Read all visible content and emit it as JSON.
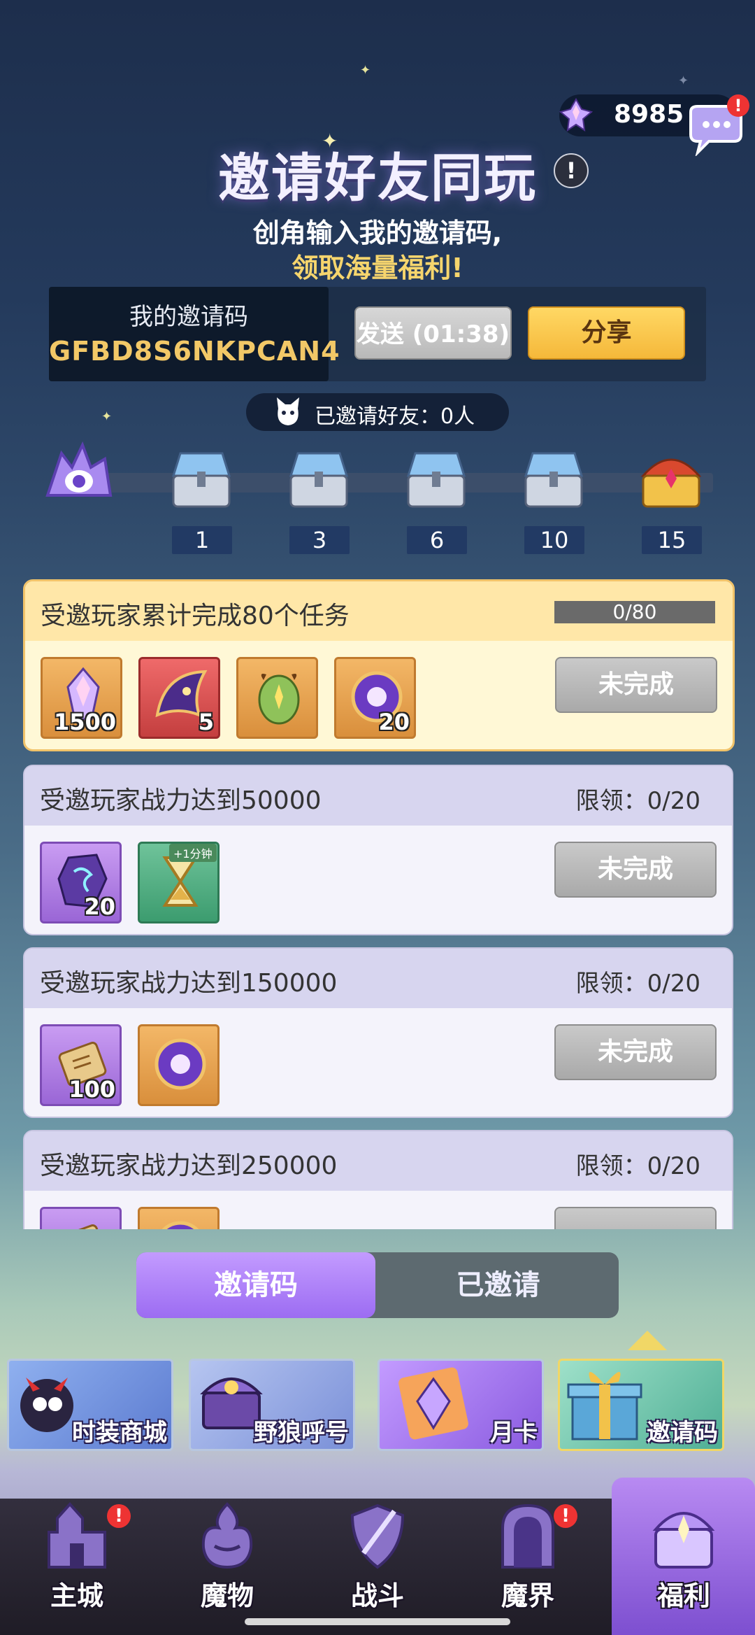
{
  "currency": {
    "value": "8985",
    "badge": "!"
  },
  "header": {
    "title": "邀请好友同玩",
    "info": "!",
    "subtitle_line1": "创角输入我的邀请码,",
    "subtitle_line2": "领取海量福利!"
  },
  "code": {
    "label": "我的邀请码",
    "value": "GFBD8S6NKPCAN4",
    "send_label": "发送 (01:38)",
    "share_label": "分享"
  },
  "invited": {
    "text": "已邀请好友：0人"
  },
  "milestones": [
    "1",
    "3",
    "6",
    "10",
    "15"
  ],
  "tasks": [
    {
      "title": "受邀玩家累计完成80个任务",
      "progress": "0/80",
      "button": "未完成",
      "items": [
        {
          "icon": "crystal-icon",
          "count": "1500"
        },
        {
          "icon": "wing-icon",
          "count": "5"
        },
        {
          "icon": "egg-icon",
          "count": ""
        },
        {
          "icon": "orb-icon",
          "count": "20"
        }
      ]
    },
    {
      "title": "受邀玩家战力达到50000",
      "limit": "限领：0/20",
      "button": "未完成",
      "items": [
        {
          "icon": "rune-stone-icon",
          "count": "20"
        },
        {
          "icon": "hourglass-icon",
          "count": "",
          "boost": "+1分钟"
        }
      ]
    },
    {
      "title": "受邀玩家战力达到150000",
      "limit": "限领：0/20",
      "button": "未完成",
      "items": [
        {
          "icon": "scroll-icon",
          "count": "100"
        },
        {
          "icon": "orb-icon",
          "count": ""
        }
      ]
    },
    {
      "title": "受邀玩家战力达到250000",
      "limit": "限领：0/20",
      "button": "",
      "items": [
        {
          "icon": "scroll-icon",
          "count": ""
        },
        {
          "icon": "orb-icon",
          "count": ""
        }
      ]
    }
  ],
  "tabs": {
    "invite_code": "邀请码",
    "invited": "已邀请"
  },
  "banners": [
    {
      "label": "时装商城",
      "color": "#6d8fd9"
    },
    {
      "label": "野狼呼号",
      "color": "#8ca5e6"
    },
    {
      "label": "月卡",
      "color": "#a87be8"
    },
    {
      "label": "邀请码",
      "color": "#6bbfa7"
    }
  ],
  "nav": {
    "items": [
      {
        "label": "主城",
        "badge": "!"
      },
      {
        "label": "魔物",
        "badge": ""
      },
      {
        "label": "战斗",
        "badge": ""
      },
      {
        "label": "魔界",
        "badge": "!"
      },
      {
        "label": "福利",
        "badge": ""
      }
    ],
    "active": "福利"
  },
  "colors": {
    "accent_purple": "#9c6cf2",
    "gold": "#f2c867",
    "highlight_card": "#fff3c8"
  }
}
